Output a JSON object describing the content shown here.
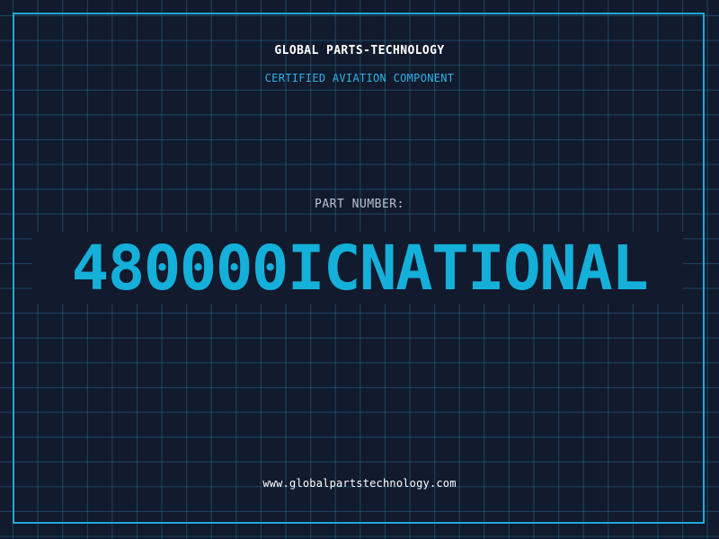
{
  "header": {
    "company": "GLOBAL PARTS-TECHNOLOGY",
    "tagline": "CERTIFIED AVIATION COMPONENT"
  },
  "part": {
    "label": "PART NUMBER:",
    "number": "480000ICNATIONAL"
  },
  "footer": {
    "website": "www.globalpartstechnology.com"
  },
  "colors": {
    "background": "#121a2d",
    "grid": "#206e8c",
    "accent": "#1fa9d8",
    "text": "#ffffff"
  }
}
